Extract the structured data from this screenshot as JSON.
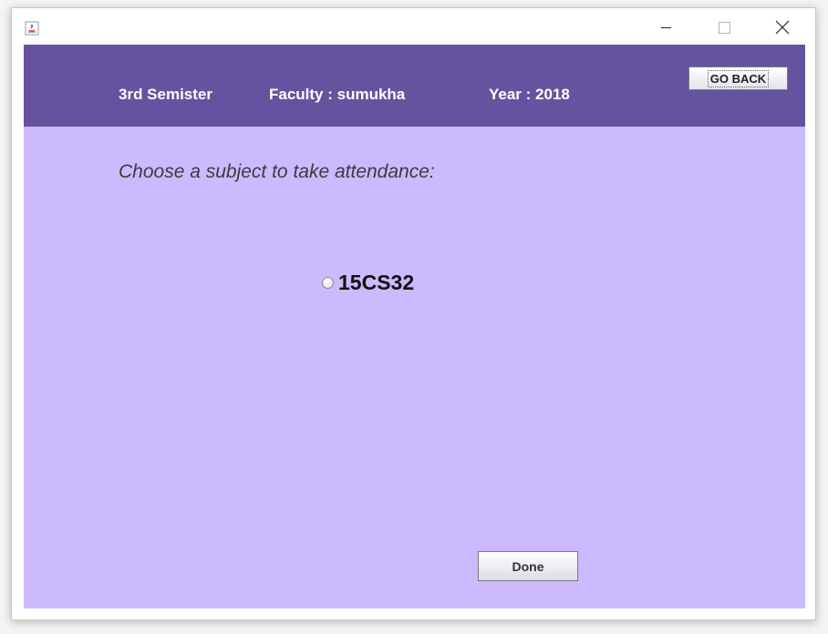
{
  "window": {
    "controls": {
      "minimize_icon": "minimize-icon",
      "maximize_icon": "maximize-icon",
      "close_glyph": "✕"
    }
  },
  "header": {
    "semester": "3rd Semister",
    "faculty": "Faculty : sumukha",
    "year": "Year : 2018",
    "go_back_label": "GO BACK",
    "background": "#66539f"
  },
  "main": {
    "prompt": "Choose a subject to take attendance:",
    "subjects": [
      {
        "label": "15CS32",
        "selected": false
      }
    ],
    "done_label": "Done",
    "background": "#cbbafd"
  }
}
